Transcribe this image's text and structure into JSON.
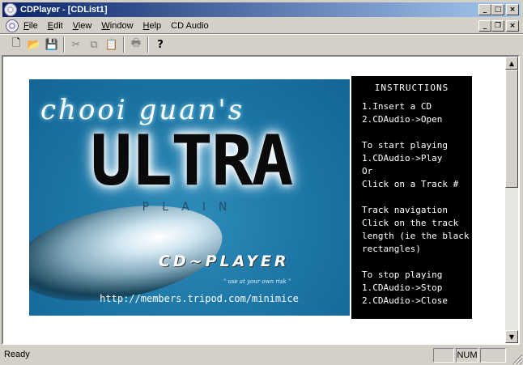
{
  "window": {
    "title": "CDPlayer - [CDList1]",
    "controls": {
      "minimize": "_",
      "maximize": "□",
      "close": "×"
    }
  },
  "menubar": {
    "items": [
      {
        "label": "File",
        "accel": "F",
        "rest": "ile"
      },
      {
        "label": "Edit",
        "accel": "E",
        "rest": "dit"
      },
      {
        "label": "View",
        "accel": "V",
        "rest": "iew"
      },
      {
        "label": "Window",
        "accel": "W",
        "rest": "indow"
      },
      {
        "label": "Help",
        "accel": "H",
        "rest": "elp"
      },
      {
        "label": "CD Audio",
        "accel": "",
        "rest": "CD Audio"
      }
    ],
    "mdi_controls": {
      "minimize": "_",
      "restore": "❐",
      "close": "×"
    }
  },
  "toolbar": {
    "icons": [
      "new-icon",
      "open-icon",
      "save-icon",
      "cut-icon",
      "copy-icon",
      "paste-icon",
      "print-icon",
      "help-icon"
    ],
    "glyphs": {
      "new": "🗋",
      "open": "📂",
      "save": "💾",
      "cut": "✂",
      "copy": "⧉",
      "paste": "📋",
      "print": "🖶",
      "help": "?"
    }
  },
  "banner": {
    "script_title": "chooi guan's",
    "logo_main": "ULTRA",
    "logo_sub": "PLAIN",
    "product": "CD~PLAYER",
    "disclaimer": "\" use at your own risk \"",
    "url": "http://members.tripod.com/minimice"
  },
  "instructions": {
    "title": "INSTRUCTIONS",
    "lines": [
      "1.Insert a CD",
      "2.CDAudio->Open",
      "",
      "To start playing",
      "1.CDAudio->Play",
      "Or",
      "Click on a Track #",
      "",
      "Track navigation",
      "Click on the track",
      "length (ie the black",
      "rectangles)",
      "",
      "To stop playing",
      "1.CDAudio->Stop",
      "2.CDAudio->Close"
    ]
  },
  "scrollbar": {
    "up": "▲",
    "down": "▼"
  },
  "statusbar": {
    "text": "Ready",
    "pane_cap": "",
    "pane_num": "NUM",
    "pane_scrl": ""
  },
  "colors": {
    "titlebar_start": "#0a246a",
    "titlebar_end": "#a6caf0",
    "face": "#d4d0c8",
    "banner_blue": "#1e78a8",
    "panel_black": "#000000"
  }
}
